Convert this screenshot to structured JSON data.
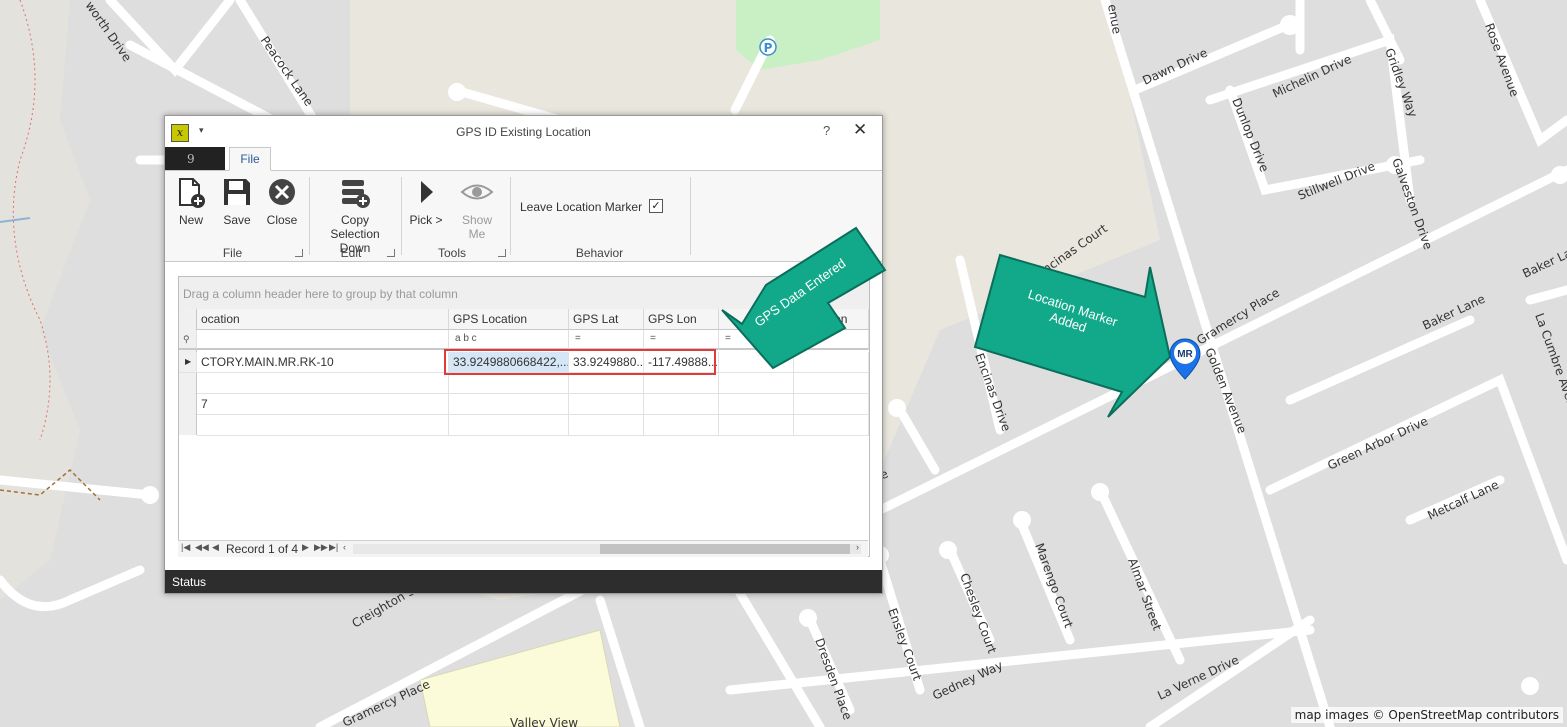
{
  "map": {
    "streets": [
      "Peacock Lane",
      "Dawn Drive",
      "Dunlop Drive",
      "Michelin Drive",
      "Gridley Way",
      "Rose Avenue",
      "Stillwell Drive",
      "Galveston Drive",
      "Gramercy Place",
      "Golden Avenue",
      "Baker Lane",
      "Baker Lane",
      "La Cumbre Avenue",
      "Green Arbor Drive",
      "Metcalf Lane",
      "Encinas Court",
      "Encinas Drive",
      "Almar Street",
      "Marengo Court",
      "Chesley Court",
      "Ensley Court",
      "Dresden Place",
      "Gedney Way",
      "La Verne Drive",
      "Creighton Street",
      "Gramercy Place",
      "Valley View",
      "Place",
      "enue",
      "worth Drive"
    ],
    "attribution": "map images © OpenStreetMap contributors",
    "parking_label": "P",
    "marker_label": "MR"
  },
  "dialog": {
    "title": "GPS ID Existing Location",
    "help": "?",
    "close": "✕",
    "quick_access": "▾",
    "file_menu_glyph": "9",
    "tab_file": "File",
    "ribbon": {
      "new": "New",
      "save": "Save",
      "close": "Close",
      "copy_selection_line1": "Copy Selection",
      "copy_selection_line2": "Down",
      "pick": "Pick >",
      "show_me": "Show Me",
      "leave_location_marker": "Leave Location Marker",
      "leave_location_marker_checked": "✓",
      "groups": [
        "File",
        "Edit",
        "Tools",
        "Behavior"
      ],
      "collapse": "⌃"
    },
    "grid": {
      "group_panel": "Drag a column header here to group by that column",
      "columns": [
        "ocation",
        "GPS Location",
        "GPS Lat",
        "GPS Lon",
        "",
        "Elevation"
      ],
      "filter_location": "a b c",
      "filter_eq": "=",
      "rows": [
        {
          "location": "CTORY.MAIN.MR.RK-10",
          "gps_location": "33.9249880668422,...",
          "gps_lat": "33.9249880...",
          "gps_lon": "-117.49888..."
        },
        {
          "location": "",
          "gps_location": "",
          "gps_lat": "",
          "gps_lon": ""
        },
        {
          "location": "7",
          "gps_location": "",
          "gps_lat": "",
          "gps_lon": ""
        },
        {
          "location": "",
          "gps_location": "",
          "gps_lat": "",
          "gps_lon": ""
        }
      ],
      "record_text": "Record 1 of 4"
    },
    "status": "Status"
  },
  "callouts": {
    "gps_data": "GPS Data Entered",
    "marker_line1": "Location Marker",
    "marker_line2": "Added"
  },
  "colors": {
    "callout": "#12a88a",
    "callout_dark": "#0b6e5a",
    "highlight": "#e03a3a",
    "marker": "#1a73e8"
  }
}
